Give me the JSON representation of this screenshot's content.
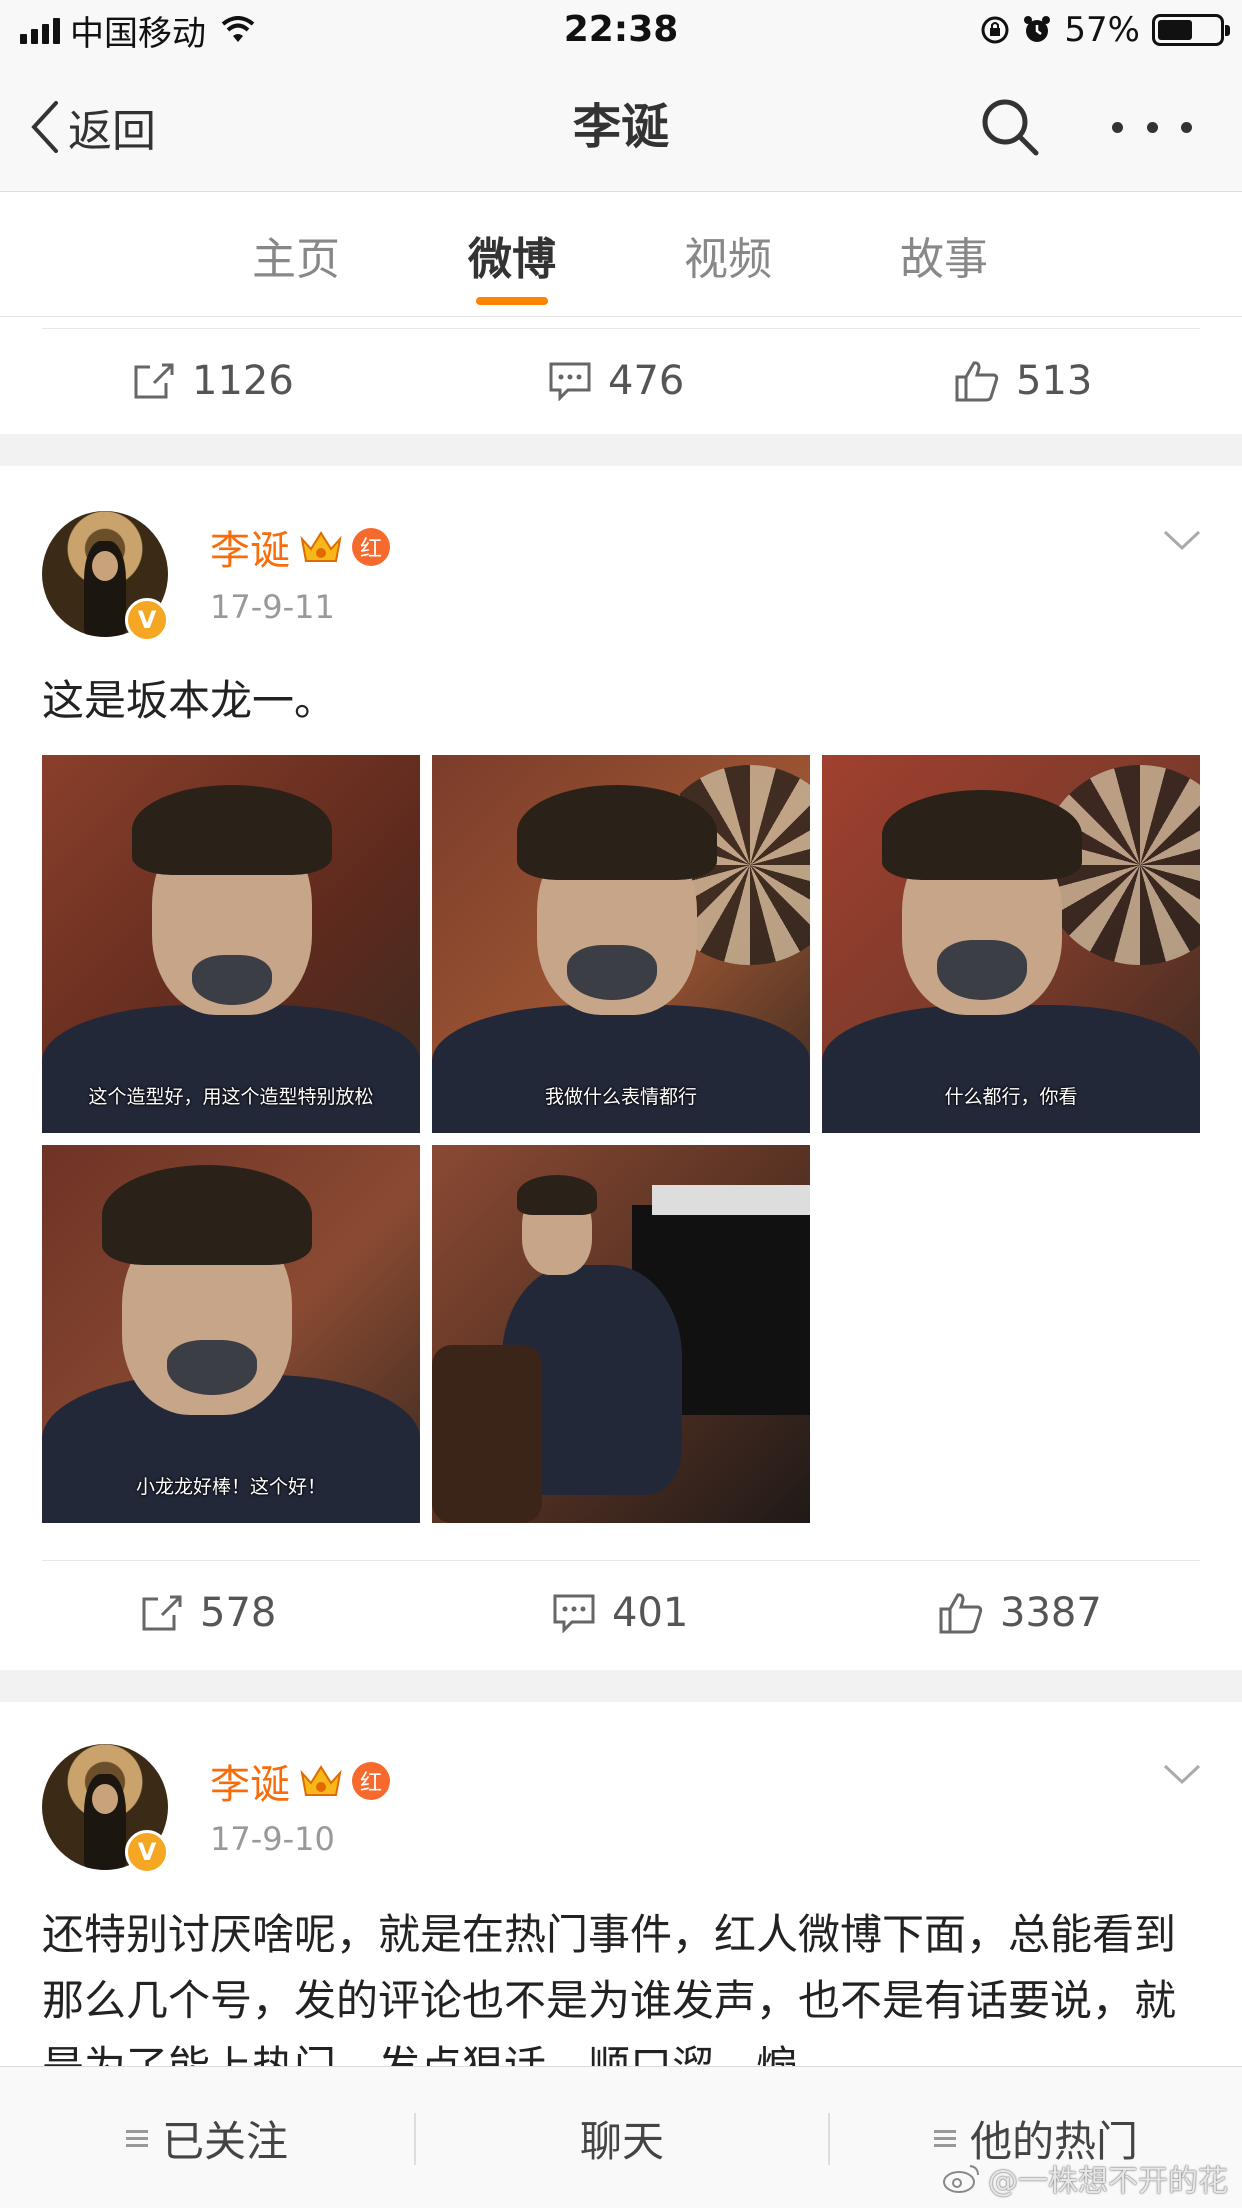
{
  "status_bar": {
    "carrier": "中国移动",
    "time": "22:38",
    "battery_percent": "57%",
    "battery_level": 0.57
  },
  "nav": {
    "back_label": "返回",
    "title": "李诞"
  },
  "tabs": [
    {
      "label": "主页",
      "active": false
    },
    {
      "label": "微博",
      "active": true
    },
    {
      "label": "视频",
      "active": false
    },
    {
      "label": "故事",
      "active": false
    }
  ],
  "prev_post_actions": {
    "reposts": "1126",
    "comments": "476",
    "likes": "513"
  },
  "posts": [
    {
      "author": "李诞",
      "verified_mark": "V",
      "red_badge": "红",
      "date": "17-9-11",
      "text": "这是坂本龙一。",
      "images": [
        {
          "caption": "这个造型好，用这个造型特别放松"
        },
        {
          "caption": "我做什么表情都行"
        },
        {
          "caption": "什么都行，你看"
        },
        {
          "caption": "小龙龙好棒！这个好！"
        },
        {
          "caption": ""
        }
      ],
      "actions": {
        "reposts": "578",
        "comments": "401",
        "likes": "3387"
      }
    },
    {
      "author": "李诞",
      "verified_mark": "V",
      "red_badge": "红",
      "date": "17-9-10",
      "text": "还特别讨厌啥呢，就是在热门事件，红人微博下面，总能看到那么几个号，发的评论也不是为谁发声，也不是有话要说，就是为了能上热门，发点狠话，顺口溜，煽"
    }
  ],
  "bottom_bar": {
    "following": "已关注",
    "chat": "聊天",
    "hot": "他的热门"
  },
  "watermark": "@一株想不开的花",
  "colors": {
    "accent": "#ff8200",
    "author": "#f86d0b",
    "badge": "#f5a623"
  }
}
